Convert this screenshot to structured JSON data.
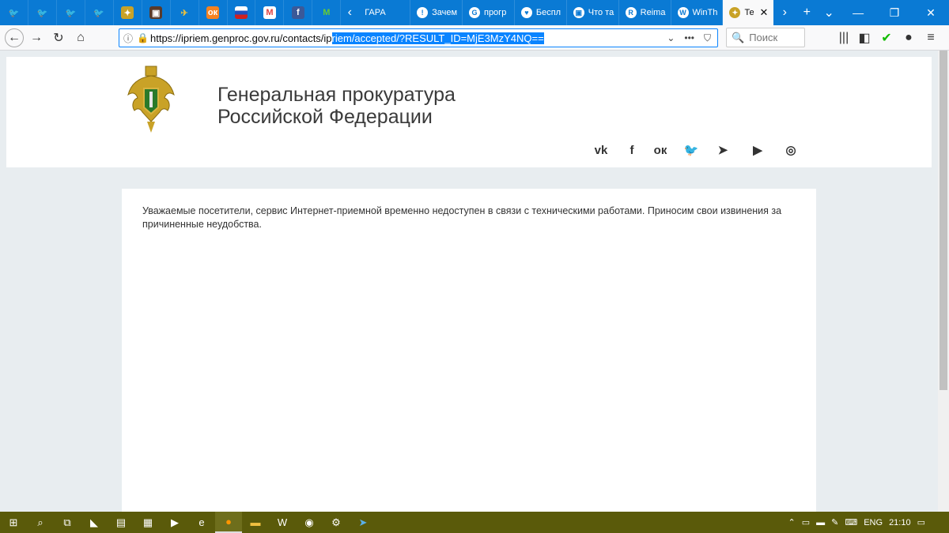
{
  "tabs": {
    "pinned_icons": [
      "twitter-icon",
      "twitter-icon",
      "twitter-icon",
      "twitter-icon",
      "emblem-icon",
      "image-icon",
      "airforce-icon",
      "odnoklassniki-icon",
      "flag-icon",
      "gmail-icon",
      "facebook-icon",
      "m-icon"
    ],
    "items": [
      {
        "label": "ГАРА",
        "icon": "t"
      },
      {
        "label": "Зачем",
        "icon": "!"
      },
      {
        "label": "прогр",
        "icon": "G"
      },
      {
        "label": "Беспл",
        "icon": "♥"
      },
      {
        "label": "Что та",
        "icon": "▣"
      },
      {
        "label": "Reima",
        "icon": "R"
      },
      {
        "label": "WinTh",
        "icon": "W"
      },
      {
        "label": "Те",
        "icon": "✦"
      }
    ]
  },
  "url": {
    "prefix": "https://ipriem.genproc.gov.ru/contacts/ip",
    "selected": "riem/accepted/?RESULT_ID=MjE3MzY4NQ=="
  },
  "search": {
    "placeholder": "Поиск"
  },
  "site": {
    "title_line1": "Генеральная прокуратура",
    "title_line2": "Российской Федерации",
    "social": [
      "vk-icon",
      "facebook-icon",
      "odnoklassniki-icon",
      "twitter-icon",
      "telegram-icon",
      "youtube-icon",
      "instagram-icon"
    ],
    "message": "Уважаемые посетители, сервис Интернет-приемной временно недоступен в связи с техническими работами. Приносим свои извинения за причиненные неудобства."
  },
  "taskbar": {
    "lang": "ENG",
    "time": "21:10"
  }
}
